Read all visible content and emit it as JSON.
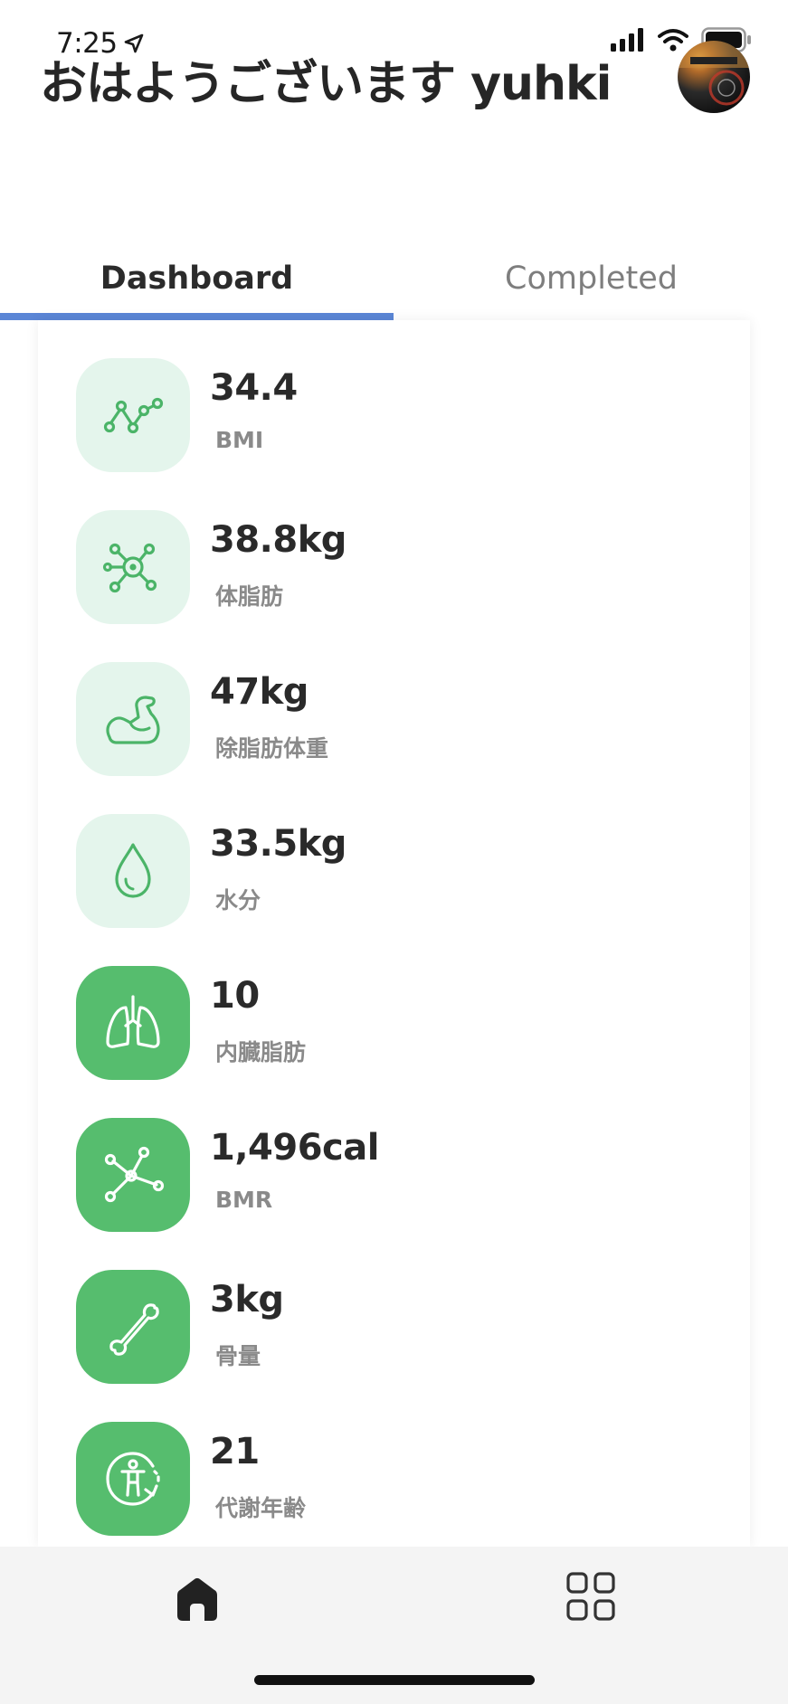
{
  "status_bar": {
    "time": "7:25"
  },
  "header": {
    "greeting": "おはようございます yuhki"
  },
  "tabs": [
    {
      "label": "Dashboard",
      "active": true
    },
    {
      "label": "Completed",
      "active": false
    }
  ],
  "metrics": [
    {
      "value": "34.4",
      "label": "BMI",
      "icon": "trend-chart-icon",
      "style": "light"
    },
    {
      "value": "38.8kg",
      "label": "体脂肪",
      "icon": "molecule-icon",
      "style": "light"
    },
    {
      "value": "47kg",
      "label": "除脂肪体重",
      "icon": "muscle-arm-icon",
      "style": "light"
    },
    {
      "value": "33.5kg",
      "label": "水分",
      "icon": "water-drop-icon",
      "style": "light"
    },
    {
      "value": "10",
      "label": "内臓脂肪",
      "icon": "lungs-icon",
      "style": "solid"
    },
    {
      "value": "1,496cal",
      "label": "BMR",
      "icon": "network-nodes-icon",
      "style": "solid"
    },
    {
      "value": "3kg",
      "label": "骨量",
      "icon": "bone-icon",
      "style": "solid"
    },
    {
      "value": "21",
      "label": "代謝年齢",
      "icon": "metabolic-age-icon",
      "style": "solid"
    }
  ],
  "bottom_nav": [
    {
      "name": "home",
      "icon": "home-icon",
      "active": true
    },
    {
      "name": "menu",
      "icon": "grid-icon",
      "active": false
    }
  ],
  "colors": {
    "accent": "#5b86d6",
    "green": "#56bd6e",
    "green_light": "#e4f5ec"
  }
}
